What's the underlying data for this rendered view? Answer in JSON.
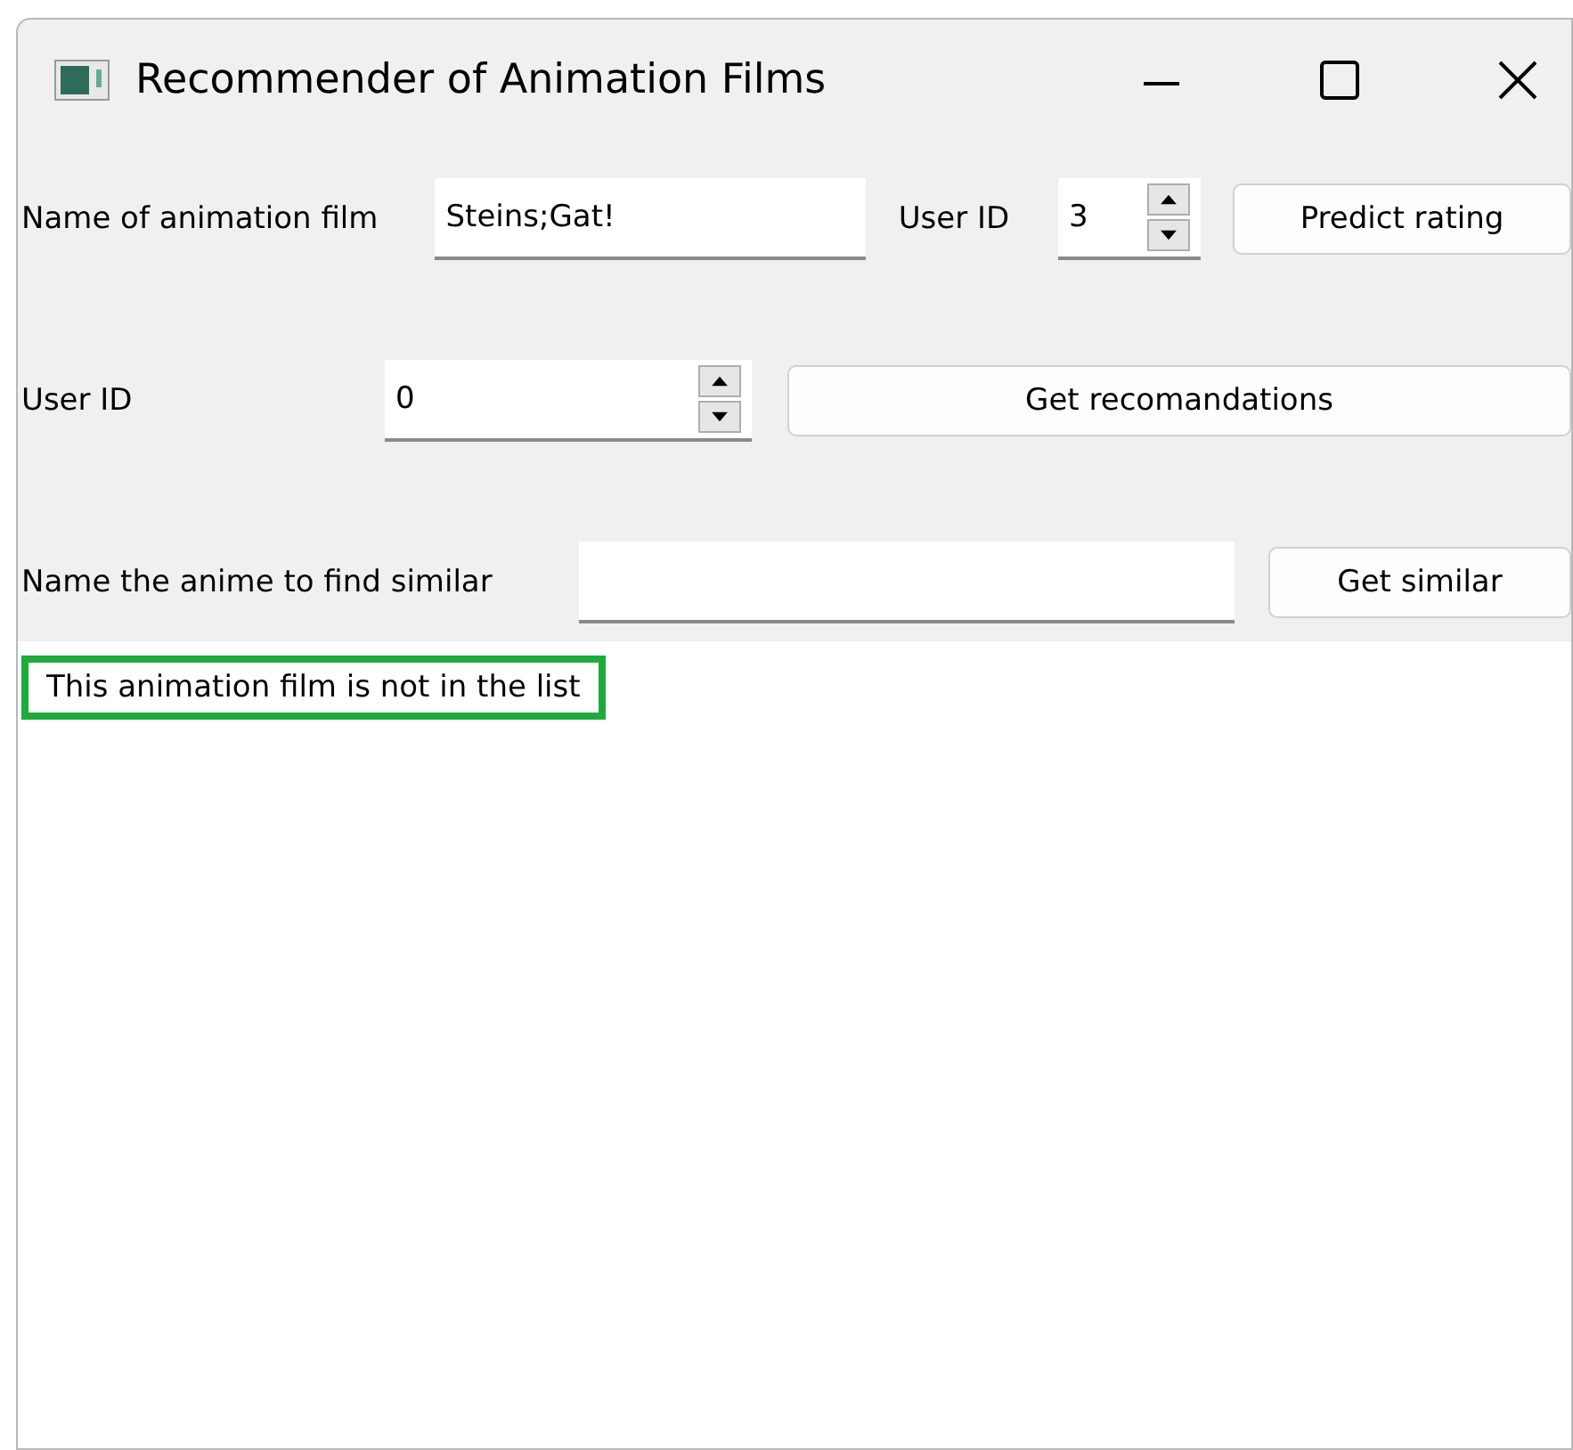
{
  "window": {
    "title": "Recommender of Animation Films"
  },
  "rating_form": {
    "film_label": "Name of animation film",
    "film_value": "Steins;Gat!",
    "user_label": "User ID",
    "user_value": "3",
    "button": "Predict rating"
  },
  "recommend_form": {
    "user_label": "User ID",
    "user_value": "0",
    "button": "Get recomandations"
  },
  "similar_form": {
    "label": "Name the anime to find similar",
    "button": "Get similar"
  },
  "result": {
    "message": "This animation film is not in the list",
    "highlighted": true
  }
}
